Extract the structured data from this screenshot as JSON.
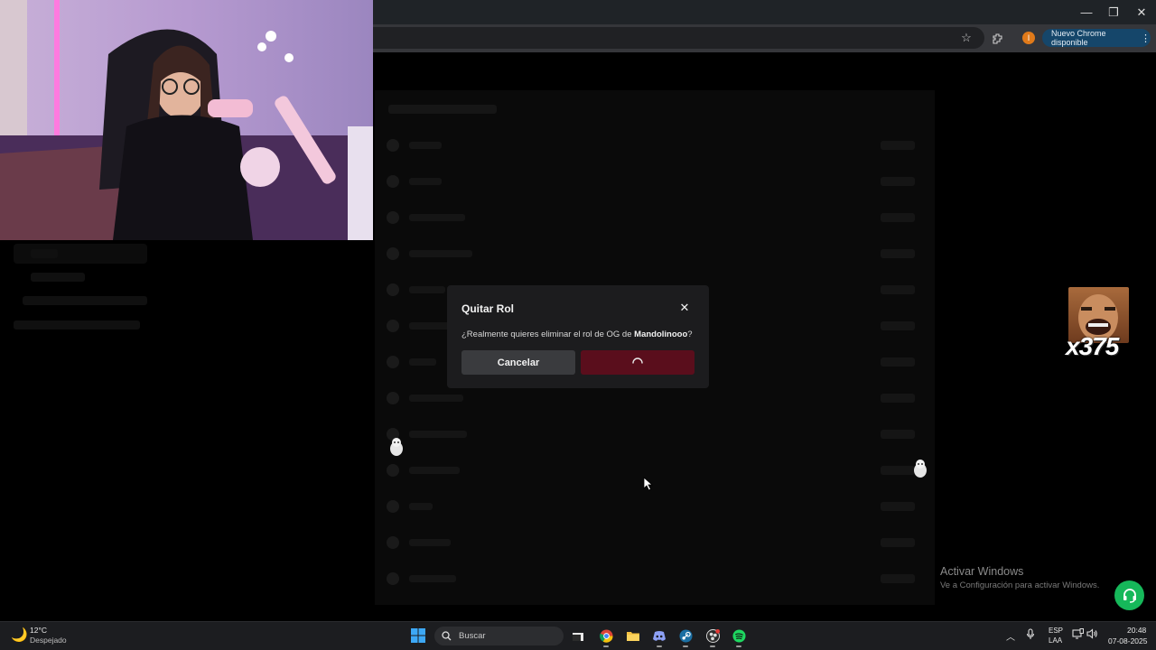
{
  "browser": {
    "update_chip": "Nuevo Chrome disponible",
    "profile_initial": "I",
    "window_controls": {
      "minimize": "—",
      "maximize": "❐",
      "close": "✕"
    }
  },
  "modal": {
    "title": "Quitar Rol",
    "close_glyph": "✕",
    "message_prefix": "¿Realmente quieres eliminar el rol de OG de ",
    "message_user": "Mandolinooo",
    "message_suffix": "?",
    "cancel_label": "Cancelar",
    "confirm_state": "loading"
  },
  "overlay": {
    "sticker_text": "x375"
  },
  "watermark": {
    "title": "Activar Windows",
    "subtitle": "Ve a Configuración para activar Windows."
  },
  "taskbar": {
    "weather_temp": "12°C",
    "weather_desc": "Despejado",
    "search_placeholder": "Buscar",
    "lang_line1": "ESP",
    "lang_line2": "LAA",
    "time": "20:48",
    "date": "07-08-2025",
    "apps": [
      "file-explorer",
      "chrome",
      "folder",
      "discord",
      "steam",
      "obs",
      "spotify"
    ]
  },
  "colors": {
    "confirm_button": "#5a0e1c",
    "support_fab": "#16b85a",
    "update_chip": "#15466a"
  }
}
